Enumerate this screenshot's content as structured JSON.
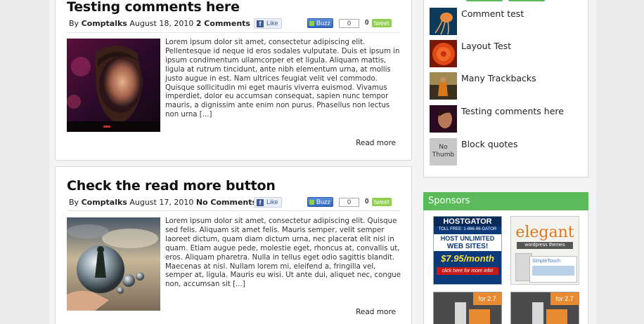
{
  "posts": [
    {
      "title": "Testing comments here",
      "by_label": "By",
      "author": "Comptalks",
      "date": "August 18, 2010",
      "comments": "2 Comments",
      "fb_like": "Like",
      "buzz": "Buzz",
      "buzz_count": "0",
      "tweet_count": "0",
      "tweet": "tweet",
      "excerpt": "Lorem ipsum dolor sit amet, consectetur adipiscing elit. Pellentesque id neque id eros sodales vulputate. Duis et ipsum in ipsum condimentum ullamcorper et et ligula. Aliquam mattis, ligula at rutrum tincidunt, ante nibh elementum urna, at mollis justo augue in est. Nam ultrices feugiat velit vel commodo. Quisque sollicitudin mi eget mauris viverra euismod. Vivamus imperdiet, dolor eu accumsan consequat, sapien nunc tempor mauris, a dignissim ante enim non purus. Phasellus non lectus non urna [...]",
      "read_more": "Read more"
    },
    {
      "title": "Check the read more button",
      "by_label": "By",
      "author": "Comptalks",
      "date": "August 17, 2010",
      "comments": "No Comments",
      "fb_like": "Like",
      "buzz": "Buzz",
      "buzz_count": "0",
      "tweet_count": "0",
      "tweet": "tweet",
      "excerpt": "Lorem ipsum dolor sit amet, consectetur adipiscing elit. Quisque sed felis. Aliquam sit amet felis. Mauris semper, velit semper laoreet dictum, quam diam dictum urna, nec placerat elit nisl in quam. Etiam augue pede, molestie eget, rhoncus at, convallis ut, eros. Aliquam pharetra. Nulla in tellus eget odio sagittis blandit. Maecenas at nisl. Nullam lorem mi, eleifend a, fringilla vel, semper at, ligula. Mauris eu wisi. Ut ante dui, aliquet nec, congue non, accumsan sit [...]",
      "read_more": "Read more"
    }
  ],
  "sidebar": {
    "recent_posts": [
      {
        "title": "Comment test"
      },
      {
        "title": "Layout Test"
      },
      {
        "title": "Many Trackbacks"
      },
      {
        "title": "Testing comments here"
      },
      {
        "title": "Block quotes",
        "no_thumb": "No Thumb"
      }
    ],
    "sponsors_title": "Sponsors",
    "ads": {
      "hostgator": {
        "brand": "HOSTGATOR",
        "phone": "TOLL FREE: 1-866-96-GATOR",
        "line1": "HOST UNLIMITED",
        "line2": "WEB SITES!",
        "price": "$7.95/month",
        "cta": "click here for more info!"
      },
      "elegant": {
        "brand": "elegant",
        "sub": "wordpress themes",
        "screen": "SimpleTouch"
      },
      "theme_badge": "for 2.7"
    }
  },
  "colors": {
    "accent_green": "#5bbb5b",
    "page_bg": "#ebebeb"
  }
}
